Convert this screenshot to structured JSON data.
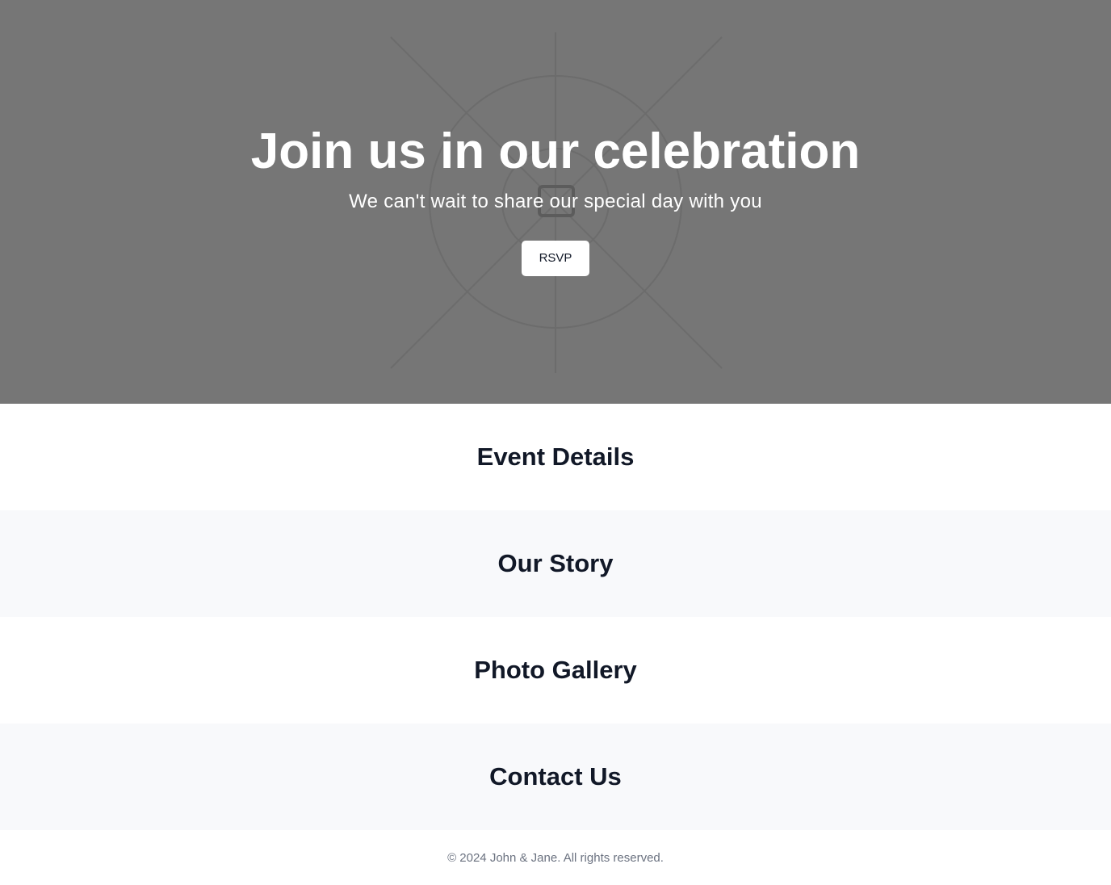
{
  "hero": {
    "title": "Join us in our celebration",
    "subtitle": "We can't wait to share our special day with you",
    "rsvp_label": "RSVP",
    "background_color": "#767676",
    "placeholder_icon": "image-placeholder-icon"
  },
  "sections": [
    {
      "heading": "Event Details"
    },
    {
      "heading": "Our Story"
    },
    {
      "heading": "Photo Gallery"
    },
    {
      "heading": "Contact Us"
    }
  ],
  "footer": {
    "copyright": "© 2024 John & Jane. All rights reserved."
  },
  "colors": {
    "heading": "#111827",
    "muted": "#6b7280",
    "alt_section_bg": "#f8f9fb"
  }
}
